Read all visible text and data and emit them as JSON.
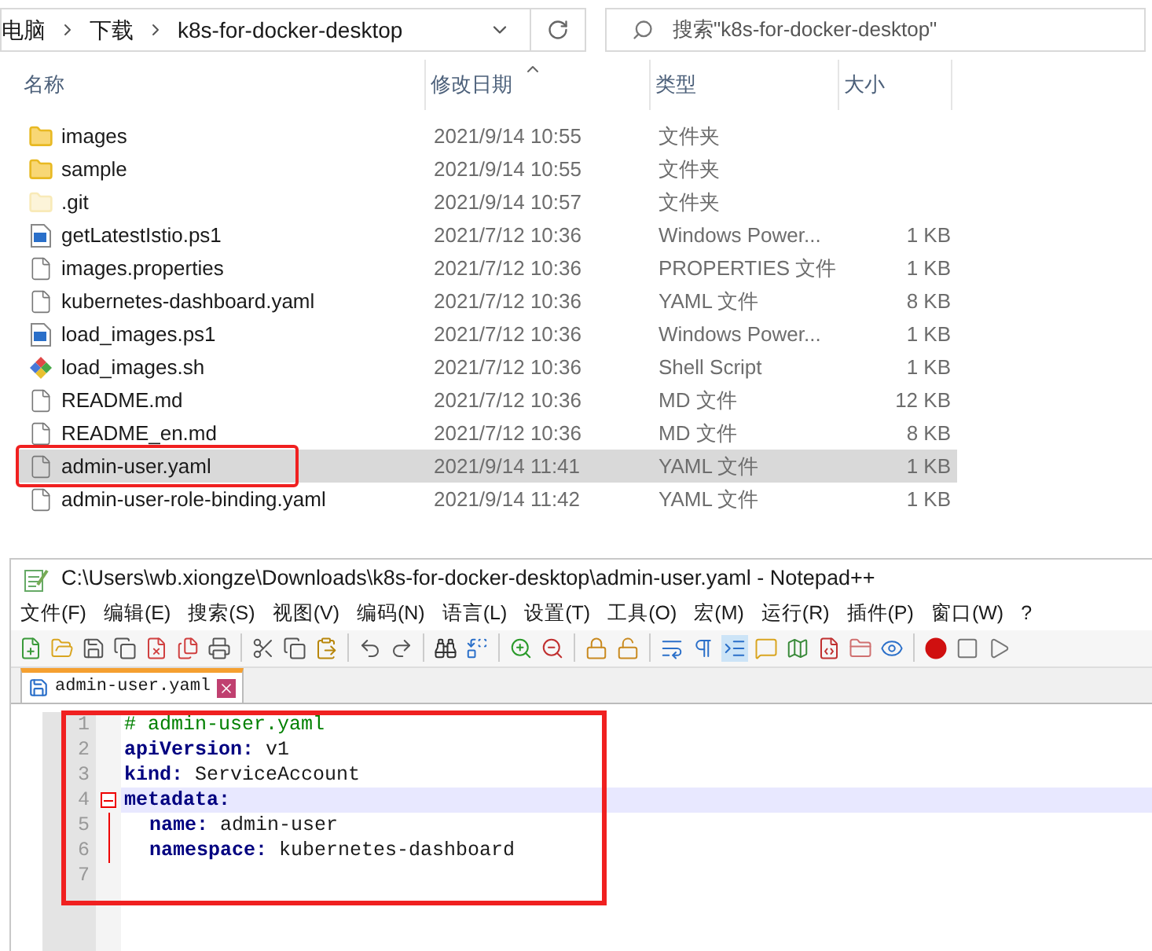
{
  "explorer": {
    "breadcrumb": [
      "电脑",
      "下载",
      "k8s-for-docker-desktop"
    ],
    "search": {
      "placeholder": "搜索\"k8s-for-docker-desktop\""
    },
    "columns": [
      {
        "label": "名称",
        "sorted": false
      },
      {
        "label": "修改日期",
        "sorted": true
      },
      {
        "label": "类型",
        "sorted": false
      },
      {
        "label": "大小",
        "sorted": false
      }
    ],
    "rows": [
      {
        "kind": "folder",
        "name": "images",
        "date": "2021/9/14 10:55",
        "type": "文件夹",
        "hidden": false,
        "selected": false,
        "highlighted": false
      },
      {
        "kind": "folder",
        "name": "sample",
        "date": "2021/9/14 10:55",
        "type": "文件夹",
        "hidden": false,
        "selected": false,
        "highlighted": false
      },
      {
        "kind": "folder",
        "name": ".git",
        "date": "2021/9/14 10:57",
        "type": "文件夹",
        "hidden": true,
        "selected": false,
        "highlighted": false
      },
      {
        "kind": "script",
        "name": "getLatestIstio.ps1",
        "date": "2021/7/12 10:36",
        "type": "Windows Power...",
        "size": "1 KB",
        "selected": false,
        "highlighted": false
      },
      {
        "kind": "file",
        "name": "images.properties",
        "date": "2021/7/12 10:36",
        "type": "PROPERTIES 文件",
        "size": "1 KB",
        "selected": false,
        "highlighted": false
      },
      {
        "kind": "file",
        "name": "kubernetes-dashboard.yaml",
        "date": "2021/7/12 10:36",
        "type": "YAML 文件",
        "size": "8 KB",
        "selected": false,
        "highlighted": false
      },
      {
        "kind": "script",
        "name": "load_images.ps1",
        "date": "2021/7/12 10:36",
        "type": "Windows Power...",
        "size": "1 KB",
        "selected": false,
        "highlighted": false
      },
      {
        "kind": "shell",
        "name": "load_images.sh",
        "date": "2021/7/12 10:36",
        "type": "Shell Script",
        "size": "1 KB",
        "selected": false,
        "highlighted": false
      },
      {
        "kind": "file",
        "name": "README.md",
        "date": "2021/7/12 10:36",
        "type": "MD 文件",
        "size": "12 KB",
        "selected": false,
        "highlighted": false
      },
      {
        "kind": "file",
        "name": "README_en.md",
        "date": "2021/7/12 10:36",
        "type": "MD 文件",
        "size": "8 KB",
        "selected": false,
        "highlighted": false
      },
      {
        "kind": "file",
        "name": "admin-user.yaml",
        "date": "2021/9/14 11:41",
        "type": "YAML 文件",
        "size": "1 KB",
        "selected": true,
        "highlighted": true
      },
      {
        "kind": "file",
        "name": "admin-user-role-binding.yaml",
        "date": "2021/9/14 11:42",
        "type": "YAML 文件",
        "size": "1 KB",
        "selected": false,
        "highlighted": false
      }
    ]
  },
  "notepad": {
    "title": "C:\\Users\\wb.xiongze\\Downloads\\k8s-for-docker-desktop\\admin-user.yaml - Notepad++",
    "menu": [
      "文件(F)",
      "编辑(E)",
      "搜索(S)",
      "视图(V)",
      "编码(N)",
      "语言(L)",
      "设置(T)",
      "工具(O)",
      "宏(M)",
      "运行(R)",
      "插件(P)",
      "窗口(W)",
      "?"
    ],
    "tabs": [
      {
        "label": "admin-user.yaml",
        "selected": true
      }
    ],
    "editor": {
      "highlighted": true,
      "lines": [
        {
          "number": "1",
          "kind": "comment",
          "text": "# admin-user.yaml",
          "current": false
        },
        {
          "number": "2",
          "kind": "pair",
          "key": "apiVersion:",
          "value": "v1",
          "current": false
        },
        {
          "number": "3",
          "kind": "pair",
          "key": "kind:",
          "value": "ServiceAccount",
          "current": false
        },
        {
          "number": "4",
          "kind": "pair",
          "key": "metadata:",
          "current": true,
          "expanded": true,
          "children": [
            {
              "number": "5",
              "kind": "pair",
              "key": "name:",
              "value": "admin-user",
              "current": false
            },
            {
              "number": "6",
              "kind": "pair",
              "key": "namespace:",
              "value": "kubernetes-dashboard",
              "current": false
            }
          ]
        },
        {
          "number": "7",
          "kind": "blank",
          "current": false
        }
      ]
    }
  }
}
